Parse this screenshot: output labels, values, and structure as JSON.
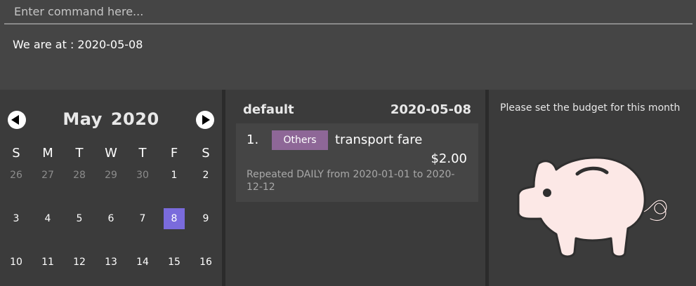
{
  "command": {
    "placeholder": "Enter command here...",
    "value": ""
  },
  "result": {
    "text": "We are at : 2020-05-08"
  },
  "calendar": {
    "month": "May",
    "year": "2020",
    "weekdays": [
      "S",
      "M",
      "T",
      "W",
      "T",
      "F",
      "S"
    ],
    "selected_day": "8",
    "weeks": [
      [
        {
          "d": "26",
          "muted": true
        },
        {
          "d": "27",
          "muted": true
        },
        {
          "d": "28",
          "muted": true
        },
        {
          "d": "29",
          "muted": true
        },
        {
          "d": "30",
          "muted": true
        },
        {
          "d": "1",
          "muted": false
        },
        {
          "d": "2",
          "muted": false
        }
      ],
      [
        {
          "d": "3",
          "muted": false
        },
        {
          "d": "4",
          "muted": false
        },
        {
          "d": "5",
          "muted": false
        },
        {
          "d": "6",
          "muted": false
        },
        {
          "d": "7",
          "muted": false
        },
        {
          "d": "8",
          "muted": false
        },
        {
          "d": "9",
          "muted": false
        }
      ],
      [
        {
          "d": "10",
          "muted": false
        },
        {
          "d": "11",
          "muted": false
        },
        {
          "d": "12",
          "muted": false
        },
        {
          "d": "13",
          "muted": false
        },
        {
          "d": "14",
          "muted": false
        },
        {
          "d": "15",
          "muted": false
        },
        {
          "d": "16",
          "muted": false
        }
      ]
    ]
  },
  "list": {
    "title": "default",
    "date": "2020-05-08",
    "items": [
      {
        "index": "1.",
        "tag": "Others",
        "description": "transport fare",
        "amount": "$2.00",
        "repeat": "Repeated DAILY from 2020-01-01 to 2020-12-12"
      }
    ]
  },
  "budget": {
    "message": "Please set the budget for this month"
  },
  "colors": {
    "selected_day": "#7a6bdc",
    "tag_bg": "#8e6797",
    "pig_fill": "#fce8e6",
    "pig_outline": "#2f2f2f"
  }
}
